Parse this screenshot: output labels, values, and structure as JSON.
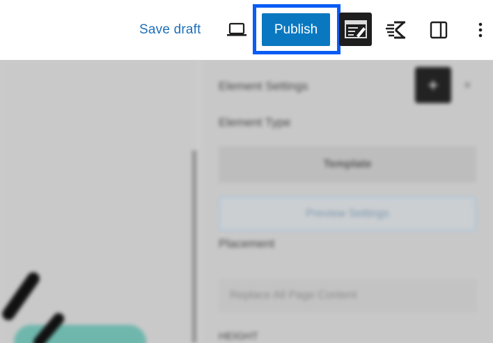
{
  "toolbar": {
    "save_draft_label": "Save draft",
    "publish_label": "Publish",
    "preview_icon": "laptop-icon",
    "editor_icon": "editor-icon",
    "k_icon": "k-logo-icon",
    "sidebar_icon": "sidebar-toggle-icon",
    "more_icon": "more-vertical-icon",
    "accent_color": "#0a78c0",
    "focus_outline_color": "#0a5cf5"
  },
  "panel": {
    "heading": "Element Settings",
    "element_type_label": "Element Type",
    "template_label": "Template",
    "preview_settings_label": "Preview Settings",
    "placement_label": "Placement",
    "placement_value": "Replace All Page Content",
    "height_label": "HEIGHT"
  }
}
